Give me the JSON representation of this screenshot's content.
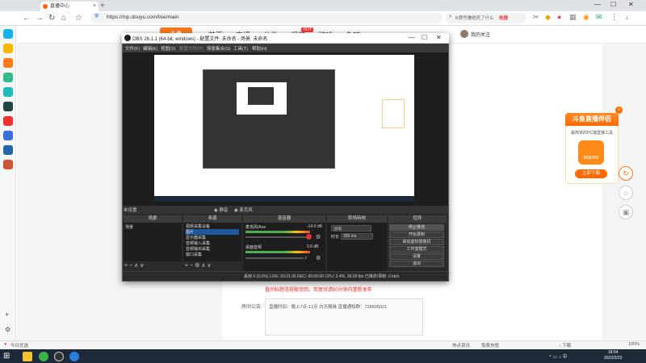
{
  "browser": {
    "tab_title": "直播中心",
    "url": "https://mp.douyu.com/live/main",
    "search_placeholder": "B牌号嫌他死了什么",
    "search_hot": "热搜"
  },
  "site": {
    "nav": [
      "首页",
      "直播",
      "分类",
      "视频",
      "游戏",
      "鱼吧"
    ],
    "hot_badge": "HOT",
    "username": "我的关注"
  },
  "content": {
    "warning": "直间标题违规被驳回，若复验请60分钟内重新发布",
    "notice_label": "房间公告:",
    "notice_text": "直播时间：晚上7点-12点 白天随缘 直播通知群：728505021"
  },
  "promo": {
    "title": "斗鱼直播伴侣",
    "subtitle": "最简单的PC端直播工具",
    "logo_text": "DOUYU",
    "download": "立即下载"
  },
  "obs": {
    "title": "OBS 26.1.1 (64-bit, windows) - 配置文件: 未命名 - 场景: 未命名",
    "menu": [
      "文件(F)",
      "编辑(E)",
      "视图(V)",
      "配置文件(P)",
      "场景集合(S)",
      "工具(T)",
      "帮助(H)"
    ],
    "mode_label": "未设置",
    "scenes_header": "场景",
    "sources_header": "来源",
    "mixer_header": "混音器",
    "transitions_header": "转场特效",
    "controls_header": "控件",
    "scene_item": "场景",
    "sources": [
      "视频采集设备",
      "图片",
      "显示器采集",
      "音频输入采集",
      "音频输出采集",
      "窗口采集"
    ],
    "mixer_tracks": [
      {
        "name": "麦克风/Aux",
        "db": "-14.0 dB",
        "level": 0.55
      },
      {
        "name": "桌面音频",
        "db": "0.0 dB",
        "level": 0.6
      }
    ],
    "transition_value": "淡出",
    "duration_label": "时长",
    "duration_value": "300 ms",
    "controls": [
      "停止推流",
      "开始录制",
      "启动虚拟摄像机",
      "工作室模式",
      "设置",
      "退出"
    ],
    "status": "丢帧 0 (0.0%)  LIVE: 00:21:36  REC: 00:00:00  CPU: 3.4%, 30.00 fps  已推流/录制: 0 kb/s"
  },
  "statusbar": {
    "left": "今日优选",
    "right_items": [
      "热点资讯",
      "免费充值",
      "↓ 下载",
      "100%"
    ]
  },
  "clock": {
    "time": "18:04",
    "date": "2022/2/23"
  }
}
